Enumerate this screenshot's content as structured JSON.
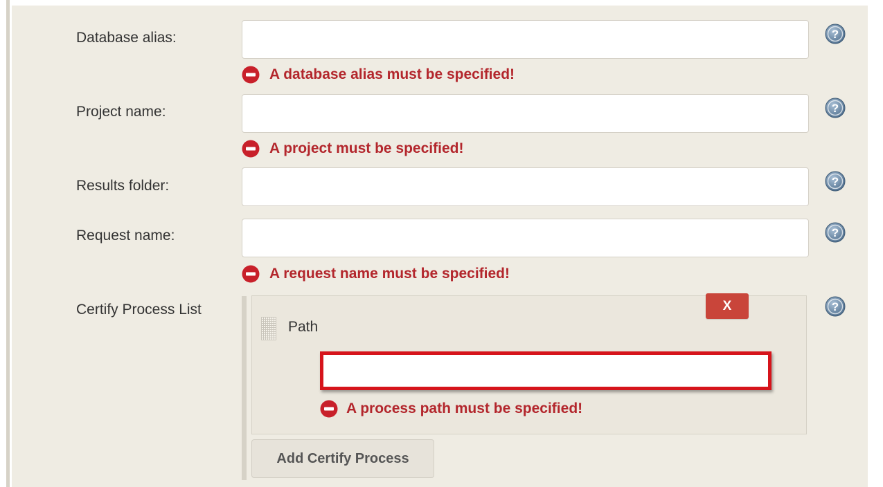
{
  "form": {
    "database_alias": {
      "label": "Database alias:",
      "value": "",
      "error": "A database alias must be specified!"
    },
    "project_name": {
      "label": "Project name:",
      "value": "",
      "error": "A project must be specified!"
    },
    "results_folder": {
      "label": "Results folder:",
      "value": ""
    },
    "request_name": {
      "label": "Request name:",
      "value": "",
      "error": "A request name must be specified!"
    },
    "certify_process_list": {
      "label": "Certify Process List",
      "delete_label": "X",
      "path_label": "Path",
      "path_value": "",
      "path_error": "A process path must be specified!",
      "add_button_label": "Add Certify Process"
    }
  },
  "icons": {
    "help": "help-icon",
    "error": "error-icon",
    "drag": "drag-handle-icon"
  },
  "colors": {
    "panel_background": "#efece3",
    "error_text": "#b3262c",
    "error_icon": "#c8202a",
    "delete_button": "#c9453a",
    "highlight_border": "#d6141b",
    "help_icon": "#5f7e9b"
  }
}
